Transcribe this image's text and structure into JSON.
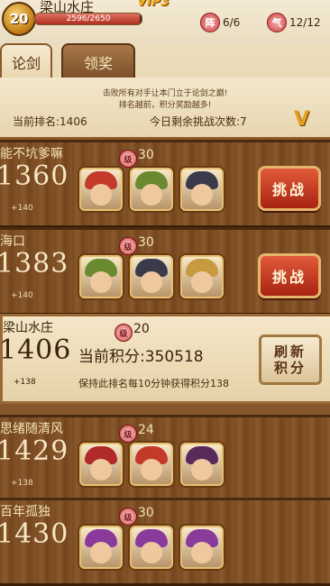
{
  "header": {
    "level": "20",
    "player_name": "梁山水庄",
    "vip": "VIP3",
    "exp_text": "2596/2650",
    "exp_fraction": 0.98,
    "stat_a_icon": "阵",
    "stat_a": "6/6",
    "stat_b_icon": "气",
    "stat_b": "12/12"
  },
  "tabs": {
    "active": "论剑",
    "other": "领奖"
  },
  "info": {
    "line1": "击败所有对手让本门立于论剑之巅!",
    "line2": "排名越前，积分奖励越多!",
    "rank": "当前排名:1406",
    "challenges": "今日剩余挑战次数:7",
    "v_icon": "V"
  },
  "rows": [
    {
      "name": "能不坑爹嘛",
      "score": "1360",
      "bonus": "+140",
      "level_icon": "级",
      "level": "30",
      "portraits": [
        "#c43a2a",
        "#6a8a30",
        "#3a3a4a"
      ],
      "button": "挑战"
    },
    {
      "name": "海口",
      "score": "1383",
      "bonus": "+140",
      "level_icon": "级",
      "level": "30",
      "portraits": [
        "#6a8a30",
        "#3a3a4a",
        "#c89a40"
      ],
      "button": "挑战"
    },
    {
      "name": "梁山水庄",
      "score": "1406",
      "bonus": "+138",
      "level_icon": "级",
      "level": "20",
      "current_points": "当前积分:350518",
      "keep_note": "保持此排名每10分钟获得积分138",
      "refresh_line1": "刷新",
      "refresh_line2": "积分"
    },
    {
      "name": "思绪随清风",
      "score": "1429",
      "bonus": "+138",
      "level_icon": "级",
      "level": "24",
      "portraits": [
        "#b02a2a",
        "#c43a2a",
        "#5a2a5a"
      ]
    },
    {
      "name": "百年孤独",
      "score": "1430",
      "bonus": "",
      "level_icon": "级",
      "level": "30",
      "portraits": [
        "#8a3a9a",
        "#8a3a9a",
        "#8a3a9a"
      ]
    }
  ]
}
